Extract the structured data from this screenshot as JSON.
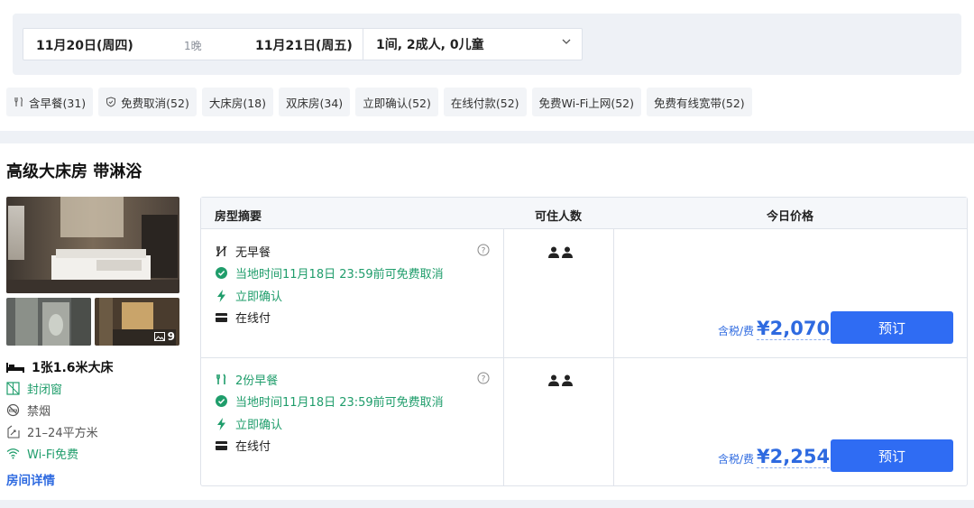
{
  "search": {
    "checkin": "11月20日(周四)",
    "nights": "1晚",
    "checkout": "11月21日(周五)",
    "guests": "1间, 2成人, 0儿童"
  },
  "filters": [
    {
      "label": "含早餐(31)",
      "icon": "utensils-icon"
    },
    {
      "label": "免费取消(52)",
      "icon": "shield-check-icon"
    },
    {
      "label": "大床房(18)",
      "icon": ""
    },
    {
      "label": "双床房(34)",
      "icon": ""
    },
    {
      "label": "立即确认(52)",
      "icon": ""
    },
    {
      "label": "在线付款(52)",
      "icon": ""
    },
    {
      "label": "免费Wi-Fi上网(52)",
      "icon": ""
    },
    {
      "label": "免费有线宽带(52)",
      "icon": ""
    }
  ],
  "room": {
    "title": "高级大床房 带淋浴",
    "photo_count": "9",
    "bed": "1张1.6米大床",
    "window": "封闭窗",
    "smoking": "禁烟",
    "area": "21–24平方米",
    "wifi": "Wi-Fi免费",
    "details_link": "房间详情"
  },
  "table": {
    "headers": {
      "summary": "房型摘要",
      "occupancy": "可住人数",
      "price": "今日价格"
    },
    "rates": [
      {
        "meal": "无早餐",
        "cancel": "当地时间11月18日 23:59前可免费取消",
        "confirm": "立即确认",
        "payment": "在线付",
        "occupancy": 2,
        "tax_label": "含税/费",
        "price": "¥2,070",
        "book_label": "预订"
      },
      {
        "meal": "2份早餐",
        "cancel": "当地时间11月18日 23:59前可免费取消",
        "confirm": "立即确认",
        "payment": "在线付",
        "occupancy": 2,
        "tax_label": "含税/费",
        "price": "¥2,254",
        "book_label": "预订"
      }
    ]
  },
  "colors": {
    "accent": "#2f6cf3",
    "green": "#1f9d6b",
    "bg": "#eef1f6"
  }
}
